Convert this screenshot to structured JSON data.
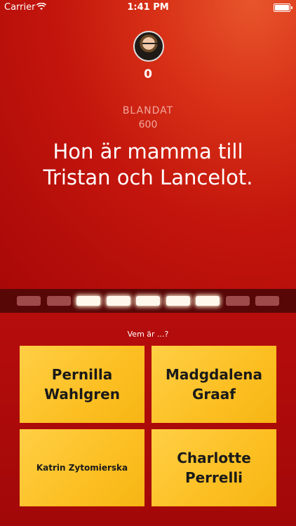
{
  "status": {
    "carrier": "Carrier",
    "time": "1:41 PM"
  },
  "player": {
    "score": "0"
  },
  "question": {
    "category": "BLANDAT",
    "points": "600",
    "text": "Hon är mamma till Tristan och Lancelot."
  },
  "progress": {
    "total": 9,
    "active": [
      2,
      3,
      4,
      5,
      6
    ]
  },
  "prompt": "Vem är ...?",
  "answers": [
    "Pernilla Wahlgren",
    "Madgdalena Graaf",
    "Katrin Zytomierska",
    "Charlotte Perrelli"
  ],
  "colors": {
    "answer_yellow": "#fcbf22",
    "background_red": "#b10a0a"
  }
}
